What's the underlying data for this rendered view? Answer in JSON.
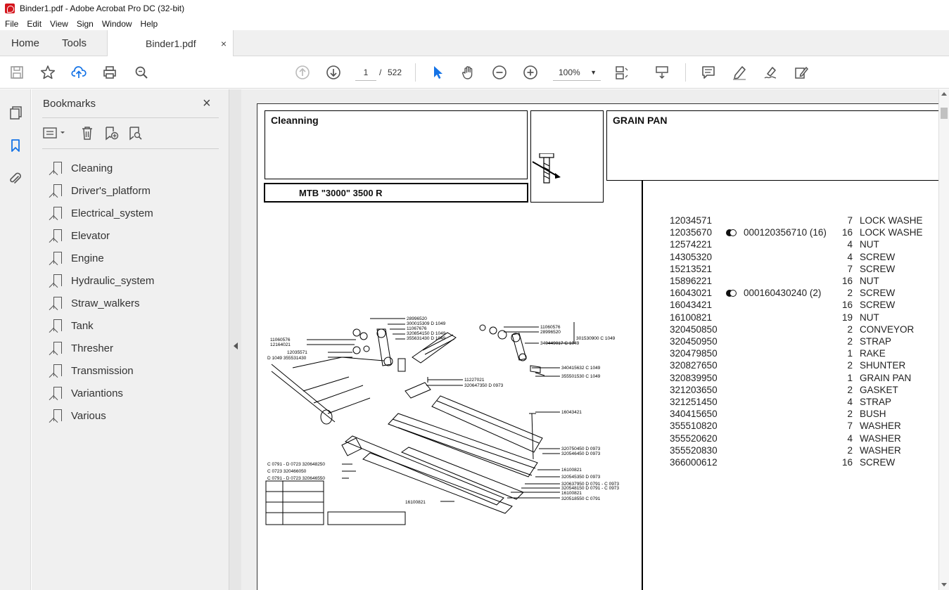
{
  "window": {
    "title": "Binder1.pdf - Adobe Acrobat Pro DC (32-bit)"
  },
  "menu": [
    "File",
    "Edit",
    "View",
    "Sign",
    "Window",
    "Help"
  ],
  "tabs": {
    "home": "Home",
    "tools": "Tools",
    "document": "Binder1.pdf",
    "close": "×"
  },
  "toolbar": {
    "page_current": "1",
    "page_separator": "/",
    "page_total": "522",
    "zoom": "100%"
  },
  "bookmarks": {
    "title": "Bookmarks",
    "close": "×",
    "items": [
      "Cleaning",
      "Driver's_platform",
      "Electrical_system",
      "Elevator",
      "Engine",
      "Hydraulic_system",
      "Straw_walkers",
      "Tank",
      "Thresher",
      "Transmission",
      "Variantions",
      "Various"
    ]
  },
  "document": {
    "section": "Cleanning",
    "model": "MTB \"3000\" 3500 R",
    "group": "GRAIN PAN",
    "parts": [
      {
        "pno": "12034571",
        "sub": "",
        "qty": "7",
        "desc": "LOCK WASHE"
      },
      {
        "pno": "12035670",
        "sub": "000120356710  (16)",
        "qty": "16",
        "desc": "LOCK WASHE"
      },
      {
        "pno": "12574221",
        "sub": "",
        "qty": "4",
        "desc": "NUT"
      },
      {
        "pno": "14305320",
        "sub": "",
        "qty": "4",
        "desc": "SCREW"
      },
      {
        "pno": "15213521",
        "sub": "",
        "qty": "7",
        "desc": "SCREW"
      },
      {
        "pno": "15896221",
        "sub": "",
        "qty": "16",
        "desc": "NUT"
      },
      {
        "pno": "16043021",
        "sub": "000160430240  (2)",
        "qty": "2",
        "desc": "SCREW"
      },
      {
        "pno": "16043421",
        "sub": "",
        "qty": "16",
        "desc": "SCREW"
      },
      {
        "pno": "16100821",
        "sub": "",
        "qty": "19",
        "desc": "NUT"
      },
      {
        "pno": "320450850",
        "sub": "",
        "qty": "2",
        "desc": "CONVEYOR"
      },
      {
        "pno": "320450950",
        "sub": "",
        "qty": "2",
        "desc": "STRAP"
      },
      {
        "pno": "320479850",
        "sub": "",
        "qty": "1",
        "desc": "RAKE"
      },
      {
        "pno": "320827650",
        "sub": "",
        "qty": "2",
        "desc": "SHUNTER"
      },
      {
        "pno": "320839950",
        "sub": "",
        "qty": "1",
        "desc": "GRAIN PAN"
      },
      {
        "pno": "321203650",
        "sub": "",
        "qty": "2",
        "desc": "GASKET"
      },
      {
        "pno": "321251450",
        "sub": "",
        "qty": "4",
        "desc": "STRAP"
      },
      {
        "pno": "340415650",
        "sub": "",
        "qty": "2",
        "desc": "BUSH"
      },
      {
        "pno": "355510820",
        "sub": "",
        "qty": "7",
        "desc": "WASHER"
      },
      {
        "pno": "355520620",
        "sub": "",
        "qty": "4",
        "desc": "WASHER"
      },
      {
        "pno": "355520830",
        "sub": "",
        "qty": "2",
        "desc": "WASHER"
      },
      {
        "pno": "366000612",
        "sub": "",
        "qty": "16",
        "desc": "SCREW"
      }
    ],
    "diagram_labels": [
      "28996520",
      "300015309 D 1049",
      "11067676",
      "320854150 D 1049",
      "355631430 D 1049",
      "11060576",
      "12164021",
      "12035571",
      "D 1049 355531430",
      "11060576",
      "28996520",
      "301530900 C 1049",
      "340449017 C 1049",
      "340415632 C 1049",
      "355501530 C 1049",
      "11227021",
      "320647350 D 0973",
      "16043421",
      "320750450 D 0973",
      "320546450 D 0973",
      "16100821",
      "320545350 D 0973",
      "320637950 D 0791 - C 0973",
      "320548150 D 0791 - C 0973",
      "16100821",
      "320518550 C 0791",
      "16100821",
      "C 0791 - D 0723 320648250",
      "C 0723 320466050",
      "C 0791 - D 0723 320646550"
    ]
  }
}
